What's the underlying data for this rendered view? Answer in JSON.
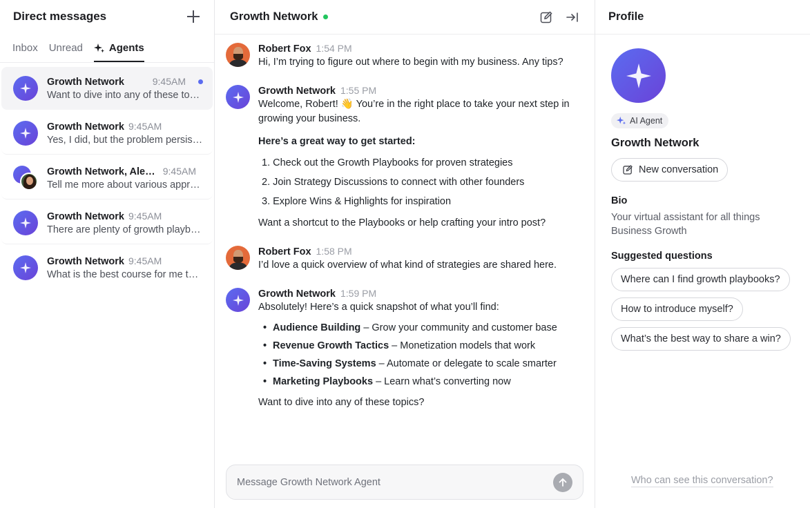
{
  "sidebar": {
    "title": "Direct messages",
    "tabs": [
      {
        "label": "Inbox"
      },
      {
        "label": "Unread"
      },
      {
        "label": "Agents"
      }
    ],
    "conversations": [
      {
        "name": "Growth Network",
        "time": "9:45AM",
        "preview": "Want to dive into any of these topics?",
        "unread": true
      },
      {
        "name": "Growth Network",
        "time": "9:45AM",
        "preview": "Yes, I did, but the problem persists after trying"
      },
      {
        "name": "Growth Network, Alexandra",
        "time": "9:45AM",
        "preview": "Tell me more about various approaches to growth"
      },
      {
        "name": "Growth Network",
        "time": "9:45AM",
        "preview": "There are plenty of growth playbooks available"
      },
      {
        "name": "Growth Network",
        "time": "9:45AM",
        "preview": "What is the best course for me to take now?"
      }
    ]
  },
  "chat": {
    "title": "Growth Network",
    "messages": [
      {
        "author": "Robert Fox",
        "time": "1:54 PM",
        "text": "Hi, I’m trying to figure out where to begin with my business. Any tips?"
      },
      {
        "author": "Growth Network",
        "time": "1:55 PM",
        "text": "Welcome, Robert! 👋 You’re in the right place to take your next step in growing your business.",
        "bold": "Here’s a great way to get started:",
        "list": [
          "1. Check out the Growth Playbooks for proven strategies",
          "2. Join Strategy Discussions to connect with other founders",
          "3. Explore Wins & Highlights for inspiration"
        ],
        "outro": "Want a shortcut to the Playbooks or help crafting your intro post?"
      },
      {
        "author": "Robert Fox",
        "time": "1:58 PM",
        "text": "I’d love a quick overview of what kind of strategies are shared here."
      },
      {
        "author": "Growth Network",
        "time": "1:59 PM",
        "text": "Absolutely! Here’s a quick snapshot of what you’ll find:",
        "bullets": [
          {
            "term": "Audience Building",
            "desc": "– Grow your community and customer base"
          },
          {
            "term": "Revenue Growth Tactics",
            "desc": "– Monetization models that work"
          },
          {
            "term": "Time-Saving Systems",
            "desc": "– Automate or delegate to scale smarter"
          },
          {
            "term": "Marketing Playbooks",
            "desc": "– Learn what’s converting now"
          }
        ],
        "outro": "Want to dive into any of these topics?"
      }
    ],
    "composer": {
      "placeholder": "Message Growth Network Agent",
      "value": ""
    },
    "bullet_glyph": "•"
  },
  "profile": {
    "title": "Profile",
    "badge": "AI Agent",
    "name": "Growth Network",
    "new_conversation": "New conversation",
    "bio_label": "Bio",
    "bio": "Your virtual assistant for all things Business Growth",
    "suggested_label": "Suggested questions",
    "suggested": [
      "Where can I find growth playbooks?",
      "How to introduce myself?",
      "What’s the best way to share a win?"
    ],
    "privacy_link": "Who can see this conversation?"
  },
  "colors": {
    "accent": "#5b6cf0",
    "online": "#22c55e"
  }
}
